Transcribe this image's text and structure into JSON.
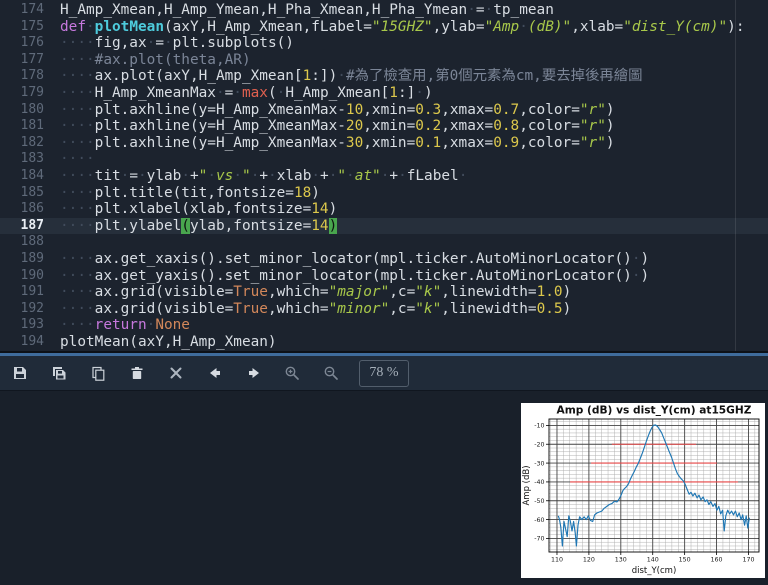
{
  "colors": {
    "editorBg": "#1c232e",
    "toolbarBg": "#202b39",
    "paneBg": "#19202a",
    "accent": "#3f6c9c",
    "curLine": "#262f3b",
    "gutter": "#5f6a7a",
    "txt": "#d8dde3",
    "ws": "#414c5c",
    "kw": "#c678dd",
    "defname": "#4ecbdc",
    "str": "#a8c84a",
    "num": "#dcc84c",
    "builtin": "#e0604f",
    "konst": "#d2875a",
    "comment": "#7b8597",
    "braceBg": "#49a64e"
  },
  "editor": {
    "current_line": 187,
    "lines": [
      {
        "n": 174,
        "segs": [
          [
            "t",
            "H_Amp_Xmean,H_Amp_Ymean,H_Pha_Xmean,H_Pha_Ymean"
          ],
          [
            "w",
            "·"
          ],
          [
            "t",
            "="
          ],
          [
            "w",
            "·"
          ],
          [
            "t",
            "tp_mean"
          ]
        ]
      },
      {
        "n": 175,
        "segs": [
          [
            "k",
            "def"
          ],
          [
            "w",
            "·"
          ],
          [
            "d",
            "plotMean"
          ],
          [
            "t",
            "(axY,H_Amp_Xmean,fLabel="
          ],
          [
            "s",
            "\"15GHZ\""
          ],
          [
            "t",
            ",ylab="
          ],
          [
            "s",
            "\"Amp"
          ],
          [
            "w",
            "·"
          ],
          [
            "s",
            "(dB)\""
          ],
          [
            "t",
            ",xlab="
          ],
          [
            "s",
            "\"dist_Y(cm)\""
          ],
          [
            "t",
            "):"
          ]
        ]
      },
      {
        "n": 176,
        "segs": [
          [
            "w",
            "····"
          ],
          [
            "t",
            "fig,ax"
          ],
          [
            "w",
            "·"
          ],
          [
            "t",
            "="
          ],
          [
            "w",
            "·"
          ],
          [
            "t",
            "plt.subplots()"
          ]
        ]
      },
      {
        "n": 177,
        "segs": [
          [
            "w",
            "····"
          ],
          [
            "m",
            "#ax.plot(theta,AR)"
          ]
        ]
      },
      {
        "n": 178,
        "segs": [
          [
            "w",
            "····"
          ],
          [
            "t",
            "ax.plot(axY,H_Amp_Xmean["
          ],
          [
            "n",
            "1"
          ],
          [
            "t",
            ":])"
          ],
          [
            "w",
            "·"
          ],
          [
            "m",
            "#為了檢查用,第0個元素為cm,要去掉後再繪圖"
          ]
        ]
      },
      {
        "n": 179,
        "segs": [
          [
            "w",
            "····"
          ],
          [
            "t",
            "H_Amp_XmeanMax"
          ],
          [
            "w",
            "·"
          ],
          [
            "t",
            "="
          ],
          [
            "w",
            "·"
          ],
          [
            "b",
            "max"
          ],
          [
            "t",
            "("
          ],
          [
            "w",
            "·"
          ],
          [
            "t",
            "H_Amp_Xmean["
          ],
          [
            "n",
            "1"
          ],
          [
            "t",
            ":]"
          ],
          [
            "w",
            "·"
          ],
          [
            "t",
            ")"
          ]
        ]
      },
      {
        "n": 180,
        "segs": [
          [
            "w",
            "····"
          ],
          [
            "t",
            "plt.axhline(y=H_Amp_XmeanMax-"
          ],
          [
            "n",
            "10"
          ],
          [
            "t",
            ",xmin="
          ],
          [
            "n",
            "0.3"
          ],
          [
            "t",
            ",xmax="
          ],
          [
            "n",
            "0.7"
          ],
          [
            "t",
            ",color="
          ],
          [
            "s",
            "\"r\""
          ],
          [
            "t",
            ")"
          ]
        ]
      },
      {
        "n": 181,
        "segs": [
          [
            "w",
            "····"
          ],
          [
            "t",
            "plt.axhline(y=H_Amp_XmeanMax-"
          ],
          [
            "n",
            "20"
          ],
          [
            "t",
            ",xmin="
          ],
          [
            "n",
            "0.2"
          ],
          [
            "t",
            ",xmax="
          ],
          [
            "n",
            "0.8"
          ],
          [
            "t",
            ",color="
          ],
          [
            "s",
            "\"r\""
          ],
          [
            "t",
            ")"
          ]
        ]
      },
      {
        "n": 182,
        "segs": [
          [
            "w",
            "····"
          ],
          [
            "t",
            "plt.axhline(y=H_Amp_XmeanMax-"
          ],
          [
            "n",
            "30"
          ],
          [
            "t",
            ",xmin="
          ],
          [
            "n",
            "0.1"
          ],
          [
            "t",
            ",xmax="
          ],
          [
            "n",
            "0.9"
          ],
          [
            "t",
            ",color="
          ],
          [
            "s",
            "\"r\""
          ],
          [
            "t",
            ")"
          ]
        ]
      },
      {
        "n": 183,
        "segs": [
          [
            "w",
            "····"
          ]
        ]
      },
      {
        "n": 184,
        "segs": [
          [
            "w",
            "····"
          ],
          [
            "t",
            "tit"
          ],
          [
            "w",
            "·"
          ],
          [
            "t",
            "="
          ],
          [
            "w",
            "·"
          ],
          [
            "t",
            "ylab"
          ],
          [
            "w",
            "·"
          ],
          [
            "t",
            "+"
          ],
          [
            "s",
            "\""
          ],
          [
            "w",
            "·"
          ],
          [
            "s",
            "vs"
          ],
          [
            "w",
            "·"
          ],
          [
            "s",
            "\""
          ],
          [
            "w",
            "·"
          ],
          [
            "t",
            "+"
          ],
          [
            "w",
            "·"
          ],
          [
            "t",
            "xlab"
          ],
          [
            "w",
            "·"
          ],
          [
            "t",
            "+"
          ],
          [
            "w",
            "·"
          ],
          [
            "s",
            "\""
          ],
          [
            "w",
            "·"
          ],
          [
            "s",
            "at\""
          ],
          [
            "w",
            "·"
          ],
          [
            "t",
            "+"
          ],
          [
            "w",
            "·"
          ],
          [
            "t",
            "fLabel"
          ],
          [
            "w",
            "·"
          ]
        ]
      },
      {
        "n": 185,
        "segs": [
          [
            "w",
            "····"
          ],
          [
            "t",
            "plt.title(tit,fontsize="
          ],
          [
            "n",
            "18"
          ],
          [
            "t",
            ")"
          ]
        ]
      },
      {
        "n": 186,
        "segs": [
          [
            "w",
            "····"
          ],
          [
            "t",
            "plt.xlabel(xlab,fontsize="
          ],
          [
            "n",
            "14"
          ],
          [
            "t",
            ")"
          ]
        ]
      },
      {
        "n": 187,
        "segs": [
          [
            "w",
            "····"
          ],
          [
            "t",
            "plt.ylabel"
          ],
          [
            "g",
            "("
          ],
          [
            "t",
            "ylab,fontsize="
          ],
          [
            "n",
            "14"
          ],
          [
            "g",
            ")"
          ]
        ]
      },
      {
        "n": 188,
        "segs": []
      },
      {
        "n": 189,
        "segs": [
          [
            "w",
            "····"
          ],
          [
            "t",
            "ax.get_xaxis().set_minor_locator(mpl.ticker.AutoMinorLocator()"
          ],
          [
            "w",
            "·"
          ],
          [
            "t",
            ")"
          ]
        ]
      },
      {
        "n": 190,
        "segs": [
          [
            "w",
            "····"
          ],
          [
            "t",
            "ax.get_yaxis().set_minor_locator(mpl.ticker.AutoMinorLocator()"
          ],
          [
            "w",
            "·"
          ],
          [
            "t",
            ")"
          ]
        ]
      },
      {
        "n": 191,
        "segs": [
          [
            "w",
            "····"
          ],
          [
            "t",
            "ax.grid(visible="
          ],
          [
            "c",
            "True"
          ],
          [
            "t",
            ",which="
          ],
          [
            "s",
            "\"major\""
          ],
          [
            "t",
            ",c="
          ],
          [
            "s",
            "\"k\""
          ],
          [
            "t",
            ",linewidth="
          ],
          [
            "n",
            "1.0"
          ],
          [
            "t",
            ")"
          ]
        ]
      },
      {
        "n": 192,
        "segs": [
          [
            "w",
            "····"
          ],
          [
            "t",
            "ax.grid(visible="
          ],
          [
            "c",
            "True"
          ],
          [
            "t",
            ",which="
          ],
          [
            "s",
            "\"minor\""
          ],
          [
            "t",
            ",c="
          ],
          [
            "s",
            "\"k\""
          ],
          [
            "t",
            ",linewidth="
          ],
          [
            "n",
            "0.5"
          ],
          [
            "t",
            ")"
          ]
        ]
      },
      {
        "n": 193,
        "segs": [
          [
            "w",
            "····"
          ],
          [
            "k",
            "return"
          ],
          [
            "w",
            "·"
          ],
          [
            "c",
            "None"
          ]
        ]
      },
      {
        "n": 194,
        "segs": [
          [
            "t",
            "plotMean(axY,H_Amp_Xmean)"
          ]
        ]
      }
    ]
  },
  "toolbar": {
    "zoom_level": "78 %",
    "buttons": [
      "save-plot",
      "save-all-plots",
      "copy-plot",
      "remove-plot",
      "remove-all-plots",
      "previous-plot",
      "next-plot",
      "zoom-in",
      "zoom-out"
    ]
  },
  "chart_data": {
    "type": "line",
    "title": "Amp (dB) vs dist_Y(cm) at15GHZ",
    "xlabel": "dist_Y(cm)",
    "ylabel": "Amp (dB)",
    "xlim": [
      107.5,
      173.3
    ],
    "ylim": [
      -77.2,
      -6.6
    ],
    "xticks": [
      110,
      120,
      130,
      140,
      150,
      160,
      170
    ],
    "yticks": [
      -10,
      -20,
      -30,
      -40,
      -50,
      -60,
      -70
    ],
    "minor_step": 2,
    "grid": "major+minor",
    "major_grid_color": "#444444",
    "minor_grid_color": "#aaaaaa",
    "line_color": "#1f77b4",
    "threshold_color": "#e64545",
    "red_lines": [
      {
        "y": -20,
        "x1": 127.2,
        "x2": 153.6
      },
      {
        "y": -30,
        "x1": 120.7,
        "x2": 160.1
      },
      {
        "y": -40,
        "x1": 114.1,
        "x2": 166.7
      }
    ],
    "series": [
      {
        "name": "H_Amp_Xmean",
        "points": [
          [
            110.4,
            -58
          ],
          [
            110.8,
            -60
          ],
          [
            111.2,
            -64
          ],
          [
            111.7,
            -74
          ],
          [
            112.2,
            -61
          ],
          [
            112.7,
            -65
          ],
          [
            113.2,
            -69
          ],
          [
            113.7,
            -58
          ],
          [
            114.2,
            -61
          ],
          [
            114.7,
            -66
          ],
          [
            115.2,
            -61
          ],
          [
            115.7,
            -67
          ],
          [
            116.1,
            -74
          ],
          [
            116.6,
            -63
          ],
          [
            117.1,
            -58.5
          ],
          [
            117.8,
            -60
          ],
          [
            118.5,
            -58.5
          ],
          [
            119.2,
            -60
          ],
          [
            119.8,
            -58
          ],
          [
            120.5,
            -60.5
          ],
          [
            121.2,
            -61
          ],
          [
            121.8,
            -57.5
          ],
          [
            122.5,
            -56.5
          ],
          [
            123.2,
            -56
          ],
          [
            124,
            -55.5
          ],
          [
            124.8,
            -54
          ],
          [
            125.6,
            -53
          ],
          [
            126.4,
            -52
          ],
          [
            127.2,
            -51.5
          ],
          [
            128,
            -50.3
          ],
          [
            128.8,
            -50.6
          ],
          [
            129.5,
            -49
          ],
          [
            130.1,
            -47
          ],
          [
            130.7,
            -44.5
          ],
          [
            131.2,
            -43.5
          ],
          [
            131.8,
            -42.5
          ],
          [
            132.4,
            -41
          ],
          [
            133,
            -38.5
          ],
          [
            133.6,
            -36.5
          ],
          [
            134.2,
            -34.5
          ],
          [
            134.9,
            -32
          ],
          [
            135.5,
            -30
          ],
          [
            136.1,
            -27.5
          ],
          [
            136.8,
            -24.5
          ],
          [
            137.4,
            -21.5
          ],
          [
            138,
            -18.5
          ],
          [
            138.6,
            -15.5
          ],
          [
            139.2,
            -13
          ],
          [
            139.8,
            -11
          ],
          [
            140.3,
            -9.9
          ],
          [
            140.9,
            -9.8
          ],
          [
            141.5,
            -10.6
          ],
          [
            142.1,
            -12
          ],
          [
            142.8,
            -14
          ],
          [
            143.4,
            -16.5
          ],
          [
            144,
            -19
          ],
          [
            144.6,
            -21.5
          ],
          [
            145.2,
            -24
          ],
          [
            145.9,
            -27
          ],
          [
            146.5,
            -30
          ],
          [
            147.1,
            -33
          ],
          [
            147.7,
            -35.5
          ],
          [
            148.3,
            -37
          ],
          [
            149,
            -38.5
          ],
          [
            149.6,
            -39.5
          ],
          [
            150.2,
            -41.5
          ],
          [
            150.8,
            -44
          ],
          [
            151.4,
            -46.5
          ],
          [
            152,
            -45.5
          ],
          [
            152.6,
            -47.5
          ],
          [
            153.2,
            -46
          ],
          [
            153.9,
            -48.5
          ],
          [
            154.5,
            -47
          ],
          [
            155.1,
            -49.5
          ],
          [
            155.8,
            -48
          ],
          [
            156.4,
            -50.5
          ],
          [
            157,
            -49.5
          ],
          [
            157.6,
            -52
          ],
          [
            158.2,
            -50.5
          ],
          [
            158.9,
            -53
          ],
          [
            159.5,
            -51.5
          ],
          [
            160.1,
            -55
          ],
          [
            160.7,
            -53
          ],
          [
            161.3,
            -57
          ],
          [
            161.9,
            -55
          ],
          [
            162.4,
            -66
          ],
          [
            162.9,
            -58
          ],
          [
            163.5,
            -55
          ],
          [
            164.1,
            -57
          ],
          [
            164.7,
            -55.5
          ],
          [
            165.3,
            -57.5
          ],
          [
            165.9,
            -55.5
          ],
          [
            166.5,
            -58.5
          ],
          [
            167.1,
            -56.5
          ],
          [
            167.7,
            -60
          ],
          [
            168.2,
            -57.5
          ],
          [
            168.8,
            -63
          ],
          [
            169.3,
            -58
          ],
          [
            169.8,
            -64.5
          ],
          [
            170.3,
            -59
          ]
        ]
      }
    ]
  }
}
